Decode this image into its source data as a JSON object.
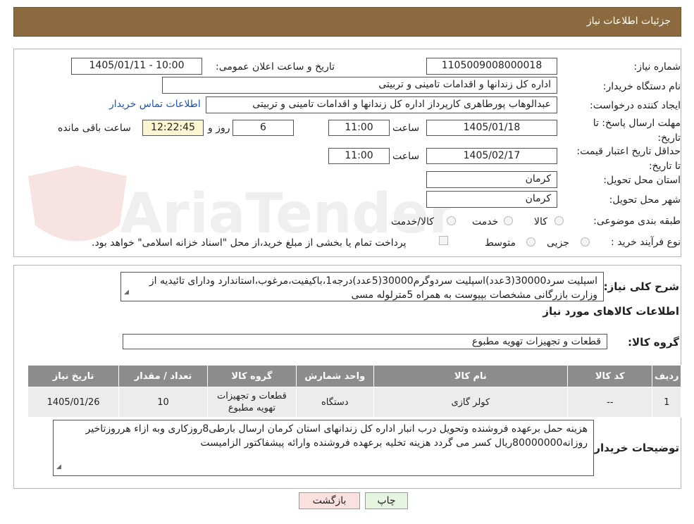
{
  "header": {
    "title": "جزئیات اطلاعات نیاز"
  },
  "details": {
    "need_number_label": "شماره نیاز:",
    "need_number": "1105009008000018",
    "announce_label": "تاریخ و ساعت اعلان عمومی:",
    "announce_value": "1405/01/11 - 10:00",
    "buyer_org_label": "نام دستگاه خریدار:",
    "buyer_org": "اداره کل زندانها و اقدامات تامینی و تربیتی",
    "creator_label": "ایجاد کننده درخواست:",
    "creator": "عبدالوهاب پورطاهری کارپرداز اداره کل زندانها و اقدامات تامینی و تربیتی",
    "contact_link": "اطلاعات تماس خریدار",
    "reply_deadline_label": "مهلت ارسال پاسخ: تا تاریخ:",
    "reply_date": "1405/01/18",
    "time_label": "ساعت",
    "reply_time": "11:00",
    "days_value": "6",
    "days_label": "روز و",
    "remaining_time": "12:22:45",
    "remaining_label": "ساعت باقی مانده",
    "validity_label": "حداقل تاریخ اعتبار قیمت: تا تاریخ:",
    "validity_date": "1405/02/17",
    "validity_time": "11:00",
    "province_label": "استان محل تحویل:",
    "province": "کرمان",
    "city_label": "شهر محل تحویل:",
    "city": "کرمان",
    "category_label": "طبقه بندی موضوعی:",
    "category_options": [
      "کالا",
      "خدمت",
      "کالا/خدمت"
    ],
    "process_label": "نوع فرآیند خرید :",
    "process_options": [
      "جزیی",
      "متوسط"
    ],
    "payment_note": "پرداخت تمام یا بخشی از مبلغ خرید،از محل \"اسناد خزانه اسلامی\" خواهد بود."
  },
  "watermark": {
    "text": "AriaTender.neT"
  },
  "summary": {
    "label": "شرح کلی نیاز:",
    "text_line1": "اسپلیت سرد30000(3عدد)اسپلیت سردوگرم30000(5عدد)درجه1،باکیفیت،مرغوب،استاندارد ودارای تائیدیه از",
    "text_line2": "وزارت بازرگانی مشخصات بپیوست به همراه 5مترلوله مسی",
    "goods_info_title": "اطلاعات کالاهای مورد نیاز",
    "goods_group_label": "گروه کالا:",
    "goods_group": "قطعات و تجهیزات تهویه مطبوع"
  },
  "table": {
    "headers": [
      "ردیف",
      "کد کالا",
      "نام کالا",
      "واحد شمارش",
      "گروه کالا",
      "تعداد / مقدار",
      "تاریخ نیاز"
    ],
    "rows": [
      [
        "1",
        "--",
        "کولر گازی",
        "دستگاه",
        "قطعات و تجهیزات تهویه مطبوع",
        "10",
        "1405/01/26"
      ]
    ]
  },
  "buyer_notes": {
    "label": "توضیحات خریدار:",
    "line1": "هزینه حمل برعهده فروشنده وتحویل درب انبار اداره کل زندانهای استان کرمان ارسال بارطی8روزکاری وبه ازاء هرروزتاخیر",
    "line2": "روزانه80000000ریال کسر می گردد هزینه تخلیه برعهده فروشنده وارائه پیشفاکتور الزامیست"
  },
  "buttons": {
    "print": "چاپ",
    "back": "بازگشت"
  },
  "colors": {
    "header_bg": "#8c6a3f",
    "table_header_bg": "#8c8c8c",
    "timer_bg": "#fbf6cf",
    "link": "#1a55b5",
    "print_btn_bg": "#e6f5df",
    "back_btn_bg": "#fbe0e0"
  }
}
